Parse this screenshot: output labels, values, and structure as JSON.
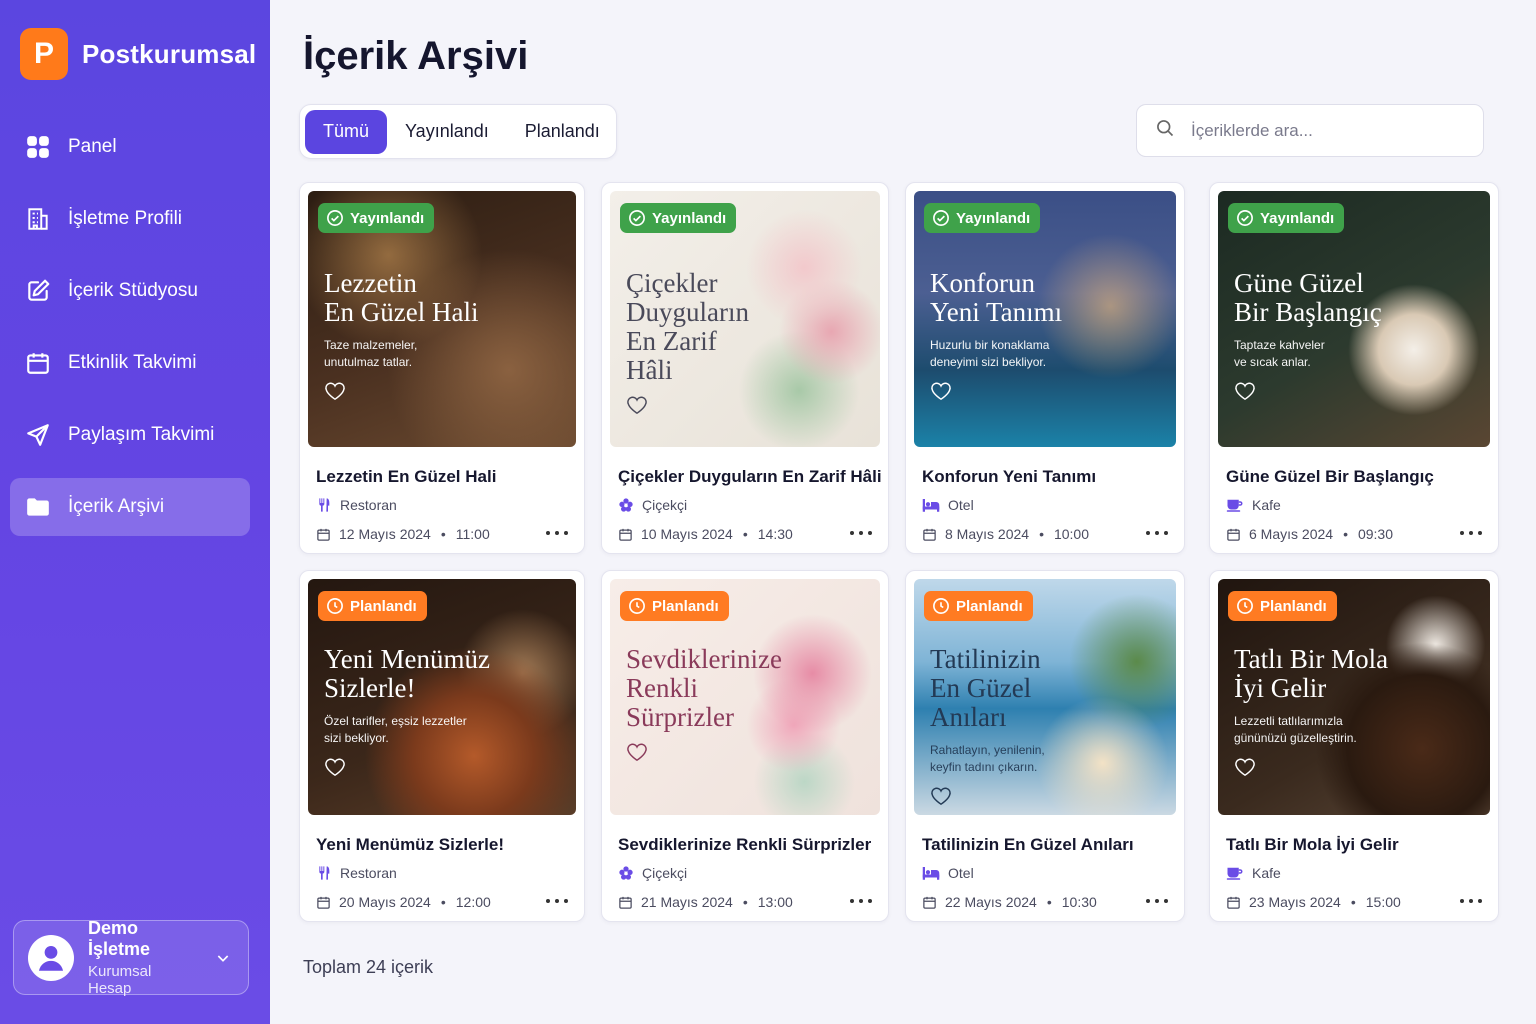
{
  "brand": {
    "name": "Postkurumsal",
    "logo_letter": "P",
    "color": "#ff7a1a"
  },
  "nav": [
    {
      "label": "Panel",
      "icon": "grid-icon",
      "active": false
    },
    {
      "label": "İşletme Profili",
      "icon": "building-icon",
      "active": false
    },
    {
      "label": "İçerik Stüdyosu",
      "icon": "edit-icon",
      "active": false
    },
    {
      "label": "Etkinlik Takvimi",
      "icon": "calendar-icon",
      "active": false
    },
    {
      "label": "Paylaşım Takvimi",
      "icon": "send-icon",
      "active": false
    },
    {
      "label": "İçerik Arşivi",
      "icon": "folder-icon",
      "active": true
    }
  ],
  "user": {
    "name": "Demo İşletme",
    "role": "Kurumsal Hesap"
  },
  "page": {
    "title": "İçerik Arşivi",
    "total": "Toplam 24 içerik"
  },
  "tabs": [
    {
      "label": "Tümü",
      "active": true
    },
    {
      "label": "Yayınlandı",
      "active": false
    },
    {
      "label": "Planlandı",
      "active": false
    }
  ],
  "search": {
    "placeholder": "İçeriklerde ara..."
  },
  "cards": [
    {
      "status": "Yayınlandı",
      "status_type": "pub",
      "ov_title": "Lezzetin\nEn Güzel Hali",
      "ov_sub": "Taze malzemeler,\nunutulmaz tatlar.",
      "title": "Lezzetin En Güzel Hali",
      "category": "Restoran",
      "cat_icon": "fork-knife-icon",
      "date": "12 Mayıs 2024",
      "time": "11:00",
      "theme": "restaurant"
    },
    {
      "status": "Yayınlandı",
      "status_type": "pub",
      "ov_title": "Çiçekler\nDuyguların\nEn Zarif\nHâli",
      "ov_sub": "",
      "title": "Çiçekler Duyguların En Zarif Hâli",
      "category": "Çiçekçi",
      "cat_icon": "flower-icon",
      "date": "10 Mayıs 2024",
      "time": "14:30",
      "theme": "flower-light"
    },
    {
      "status": "Yayınlandı",
      "status_type": "pub",
      "ov_title": "Konforun\nYeni Tanımı",
      "ov_sub": "Huzurlu bir konaklama\ndeneyimi sizi bekliyor.",
      "title": "Konforun Yeni Tanımı",
      "category": "Otel",
      "cat_icon": "bed-icon",
      "date": "8 Mayıs 2024",
      "time": "10:00",
      "theme": "hotel"
    },
    {
      "status": "Yayınlandı",
      "status_type": "pub",
      "ov_title": "Güne Güzel\nBir Başlangıç",
      "ov_sub": "Taptaze kahveler\nve sıcak anlar.",
      "title": "Güne Güzel Bir Başlangıç",
      "category": "Kafe",
      "cat_icon": "coffee-cup-icon",
      "date": "6 Mayıs 2024",
      "time": "09:30",
      "theme": "coffee"
    },
    {
      "status": "Planlandı",
      "status_type": "plan",
      "ov_title": "Yeni Menümüz\nSizlerle!",
      "ov_sub": "Özel tarifler, eşsiz lezzetler\nsizi bekliyor.",
      "title": "Yeni Menümüz Sizlerle!",
      "category": "Restoran",
      "cat_icon": "fork-knife-icon",
      "date": "20 Mayıs 2024",
      "time": "12:00",
      "theme": "food"
    },
    {
      "status": "Planlandı",
      "status_type": "plan",
      "ov_title": "Sevdiklerinize\nRenkli\nSürprizler",
      "ov_sub": "",
      "title": "Sevdiklerinize Renkli Sürprizler",
      "category": "Çiçekçi",
      "cat_icon": "flower-icon",
      "date": "21 Mayıs 2024",
      "time": "13:00",
      "theme": "flower-pink"
    },
    {
      "status": "Planlandı",
      "status_type": "plan",
      "ov_title": "Tatilinizin\nEn Güzel\nAnıları",
      "ov_sub": "Rahatlayın, yenilenin,\nkeyfin tadını çıkarın.",
      "title": "Tatilinizin En Güzel Anıları",
      "category": "Otel",
      "cat_icon": "bed-icon",
      "date": "22 Mayıs 2024",
      "time": "10:30",
      "theme": "sea"
    },
    {
      "status": "Planlandı",
      "status_type": "plan",
      "ov_title": "Tatlı Bir Mola\nİyi Gelir",
      "ov_sub": "Lezzetli tatlılarımızla\ngününüzü güzelleştirin.",
      "title": "Tatlı Bir Mola İyi Gelir",
      "category": "Kafe",
      "cat_icon": "coffee-cup-icon",
      "date": "23 Mayıs 2024",
      "time": "15:00",
      "theme": "cake"
    }
  ]
}
